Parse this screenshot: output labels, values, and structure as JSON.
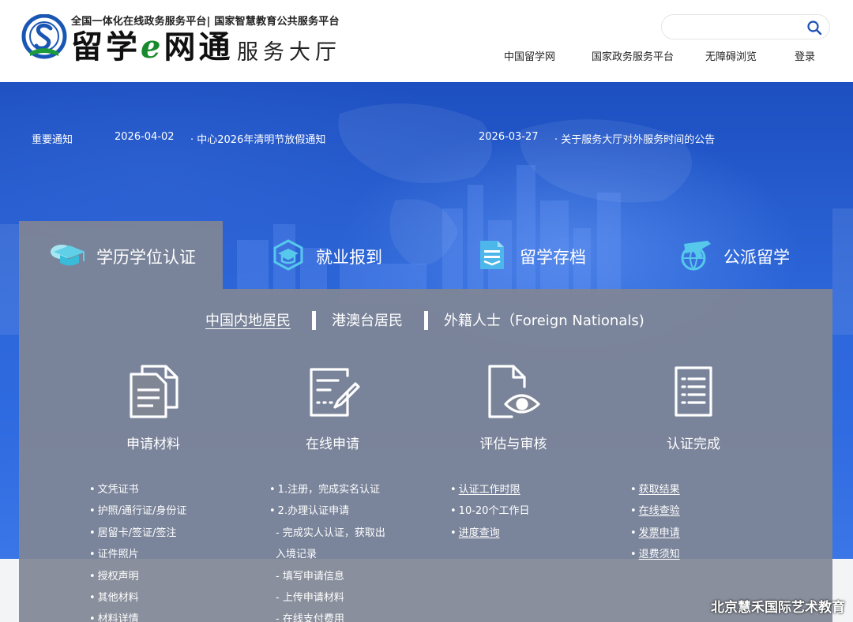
{
  "header": {
    "tagline": "全国一体化在线政务服务平台| 国家智慧教育公共服务平台",
    "brand_main": "留学",
    "brand_e": "e",
    "brand_tail": "网通",
    "brand_sub": "服务大厅",
    "search": {
      "placeholder": "",
      "value": ""
    },
    "nav": [
      "中国留学网",
      "国家政务服务平台",
      "无障碍浏览",
      "登录"
    ]
  },
  "notices": {
    "label": "重要通知",
    "items": [
      {
        "date": "2026-04-02",
        "title": "· 中心2026年清明节放假通知"
      },
      {
        "date": "2026-03-27",
        "title": "· 关于服务大厅对外服务时间的公告"
      }
    ]
  },
  "tabs": [
    {
      "label": "学历学位认证",
      "icon": "graduation-cap-icon",
      "active": true
    },
    {
      "label": "就业报到",
      "icon": "mortarboard-hexagon-icon",
      "active": false
    },
    {
      "label": "留学存档",
      "icon": "document-archive-icon",
      "active": false
    },
    {
      "label": "公派留学",
      "icon": "plane-globe-icon",
      "active": false
    }
  ],
  "subtabs": [
    "中国内地居民",
    "港澳台居民",
    "外籍人士（Foreign Nationals)"
  ],
  "steps": [
    {
      "title": "申请材料",
      "icon": "documents-icon"
    },
    {
      "title": "在线申请",
      "icon": "edit-form-icon"
    },
    {
      "title": "评估与审核",
      "icon": "review-eye-icon"
    },
    {
      "title": "认证完成",
      "icon": "checklist-icon"
    }
  ],
  "lists": {
    "materials": [
      "文凭证书",
      "护照/通行证/身份证",
      "居留卡/签证/签注",
      "证件照片",
      "授权声明",
      "其他材料",
      "材料详情"
    ],
    "online": [
      "1.注册，完成实名认证",
      "2.办理认证申请",
      "- 完成实人认证，获取出",
      "入境记录",
      "- 填写申请信息",
      "- 上传申请材料",
      "- 在线支付费用"
    ],
    "review": [
      "认证工作时限",
      "10-20个工作日",
      "进度查询"
    ],
    "complete": [
      "获取结果",
      "在线查验",
      "发票申请",
      "退费须知"
    ]
  },
  "watermark": "北京慧禾国际艺术教育"
}
